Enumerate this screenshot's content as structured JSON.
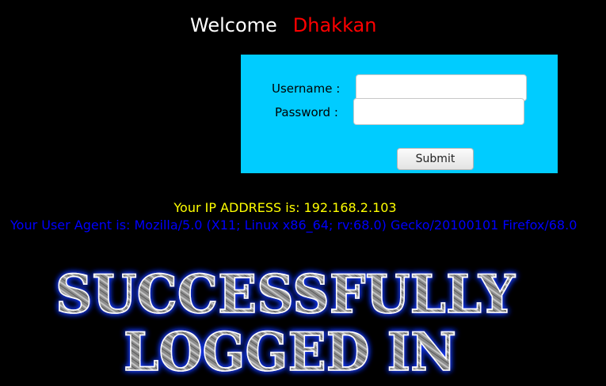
{
  "header": {
    "welcome_word": "Welcome",
    "user_name": "Dhakkan"
  },
  "login_form": {
    "username_label": "Username :",
    "password_label": "Password :",
    "username_value": "",
    "password_value": "",
    "submit_label": "Submit"
  },
  "info": {
    "ip_text": "Your IP ADDRESS is: 192.168.2.103",
    "user_agent_text": "Your User Agent is: Mozilla/5.0 (X11; Linux x86_64; rv:68.0) Gecko/20100101 Firefox/68.0"
  },
  "banner": {
    "line1": "SUCCESSFULLY",
    "line2": "LOGGED IN"
  },
  "colors": {
    "background": "#000000",
    "panel": "#00ccff",
    "welcome_word": "#ffffff",
    "user_name": "#ff0000",
    "ip_text": "#ffff00",
    "user_agent_text": "#0000ff",
    "banner_glow": "#1a3cff",
    "banner_fill": "#8a8a8a"
  }
}
